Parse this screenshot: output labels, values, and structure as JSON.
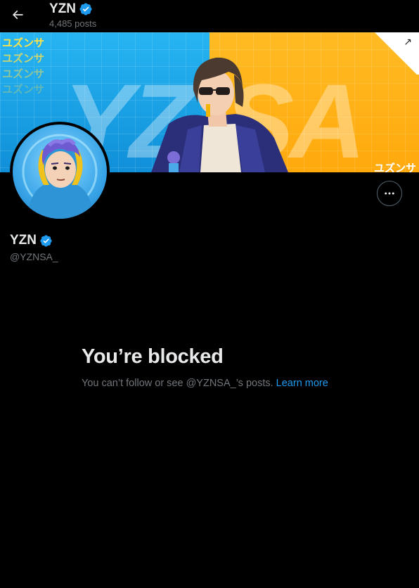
{
  "header": {
    "name": "YZN",
    "post_count": "4,485 posts"
  },
  "banner": {
    "jp_lines": [
      "ユズンサ",
      "ユズンサ",
      "ユズンサ",
      "ユズンサ"
    ],
    "jp_right": "ユズンサ",
    "big_left": "YZ",
    "big_right": "SA"
  },
  "profile": {
    "name": "YZN",
    "handle": "@YZNSA_"
  },
  "blocked": {
    "title": "You’re blocked",
    "message": "You can’t follow or see @YZNSA_’s posts.",
    "link": "Learn more"
  },
  "colors": {
    "background": "#000000",
    "verified": "#1d9bf0",
    "link": "#1d9bf0",
    "muted_text": "#71767b"
  }
}
